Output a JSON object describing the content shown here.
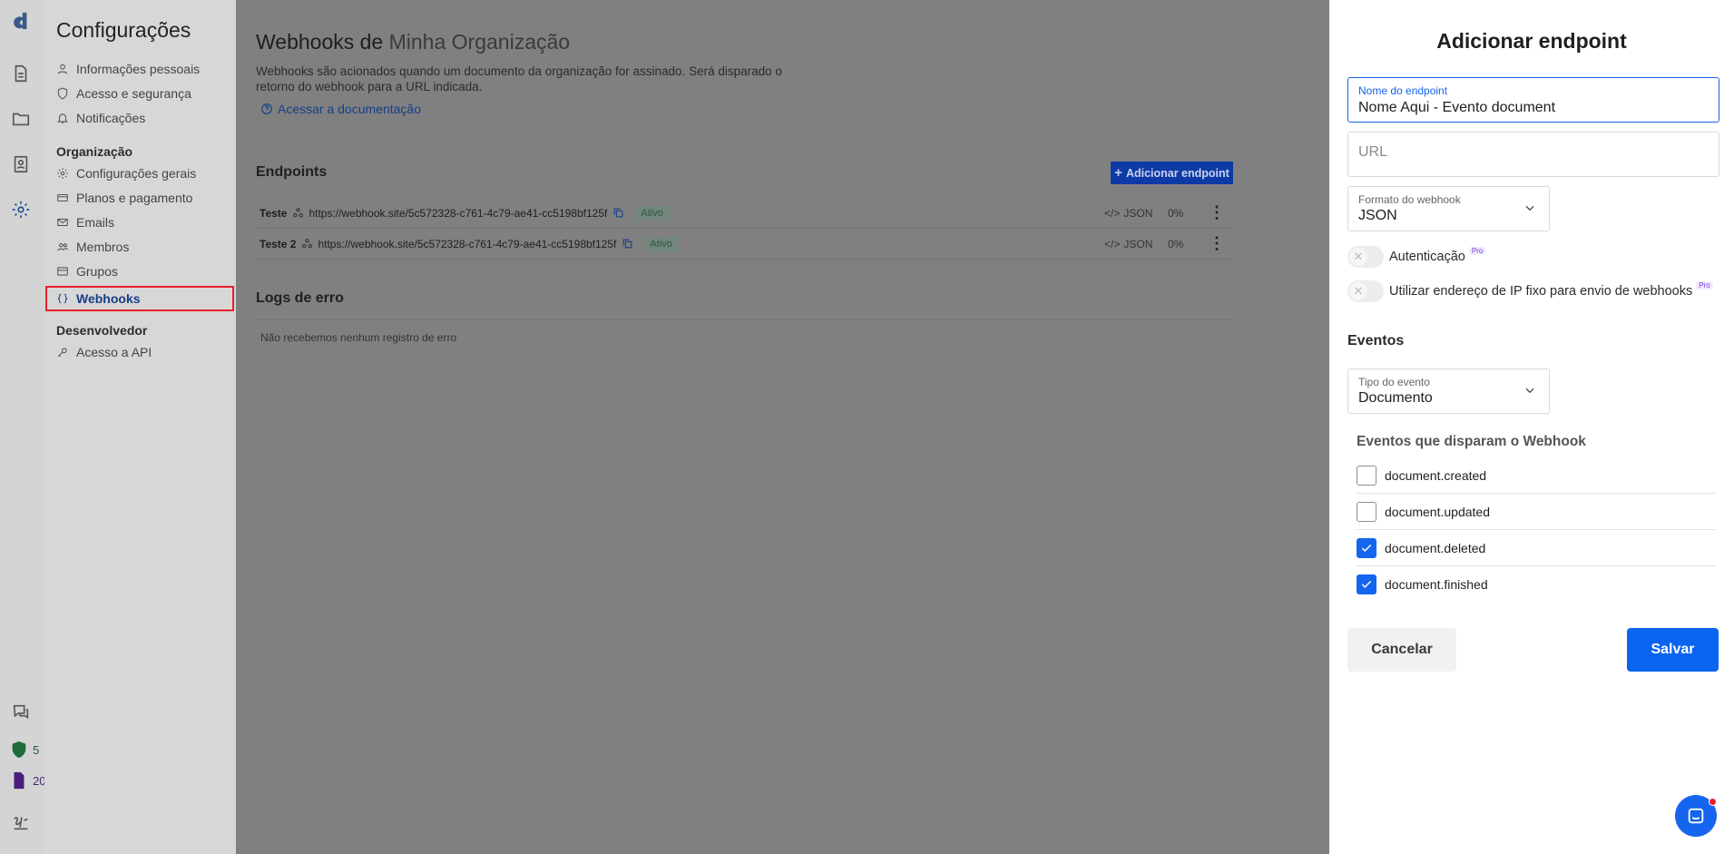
{
  "sidebar_icons": [
    "logo-icon",
    "document-icon",
    "folder-icon",
    "contacts-icon",
    "settings-icon",
    "help-icon"
  ],
  "counters": {
    "shield_count": "5",
    "doc_count": "20"
  },
  "settings_nav": {
    "title": "Configurações",
    "personal": [
      {
        "label": "Informações pessoais",
        "icon": "user-icon"
      },
      {
        "label": "Acesso e segurança",
        "icon": "shield-icon"
      },
      {
        "label": "Notificações",
        "icon": "bell-icon"
      }
    ],
    "org_group": "Organização",
    "org": [
      {
        "label": "Configurações gerais",
        "icon": "gear-icon"
      },
      {
        "label": "Planos e pagamento",
        "icon": "card-icon"
      },
      {
        "label": "Emails",
        "icon": "mail-icon"
      },
      {
        "label": "Membros",
        "icon": "members-icon"
      },
      {
        "label": "Grupos",
        "icon": "groups-icon"
      },
      {
        "label": "Webhooks",
        "icon": "braces-icon"
      }
    ],
    "dev_group": "Desenvolvedor",
    "dev": [
      {
        "label": "Acesso a API",
        "icon": "key-icon"
      }
    ]
  },
  "main": {
    "title_prefix": "Webhooks de",
    "title_org": "Minha Organização",
    "description": "Webhooks são acionados quando um documento da organização for assinado. Será disparado o retorno do webhook para a URL indicada.",
    "doc_link": "Acessar a documentação",
    "endpoints_heading": "Endpoints",
    "add_button": "Adicionar endpoint",
    "endpoints": [
      {
        "name": "Teste",
        "url": "https://webhook.site/5c572328-c761-4c79-ae41-cc5198bf125f",
        "status": "Ativo",
        "format": "JSON",
        "rate": "0%"
      },
      {
        "name": "Teste 2",
        "url": "https://webhook.site/5c572328-c761-4c79-ae41-cc5198bf125f",
        "status": "Ativo",
        "format": "JSON",
        "rate": "0%"
      }
    ],
    "error_heading": "Logs de erro",
    "error_empty": "Não recebemos nenhum registro de erro"
  },
  "drawer": {
    "title": "Adicionar endpoint",
    "name_label": "Nome do endpoint",
    "name_value": "Nome Aqui - Evento document",
    "url_placeholder": "URL",
    "format_label": "Formato do webhook",
    "format_value": "JSON",
    "auth_label": "Autenticação",
    "fixed_ip_label": "Utilizar endereço de IP fixo para envio de webhooks",
    "pro_badge": "Pro",
    "events_heading": "Eventos",
    "event_type_label": "Tipo do evento",
    "event_type_value": "Documento",
    "triggers_heading": "Eventos que disparam o Webhook",
    "events": [
      {
        "label": "document.created",
        "checked": false
      },
      {
        "label": "document.updated",
        "checked": false
      },
      {
        "label": "document.deleted",
        "checked": true
      },
      {
        "label": "document.finished",
        "checked": true
      }
    ],
    "cancel": "Cancelar",
    "save": "Salvar"
  },
  "colors": {
    "accent": "#1565ef",
    "highlight": "#e8202a"
  }
}
